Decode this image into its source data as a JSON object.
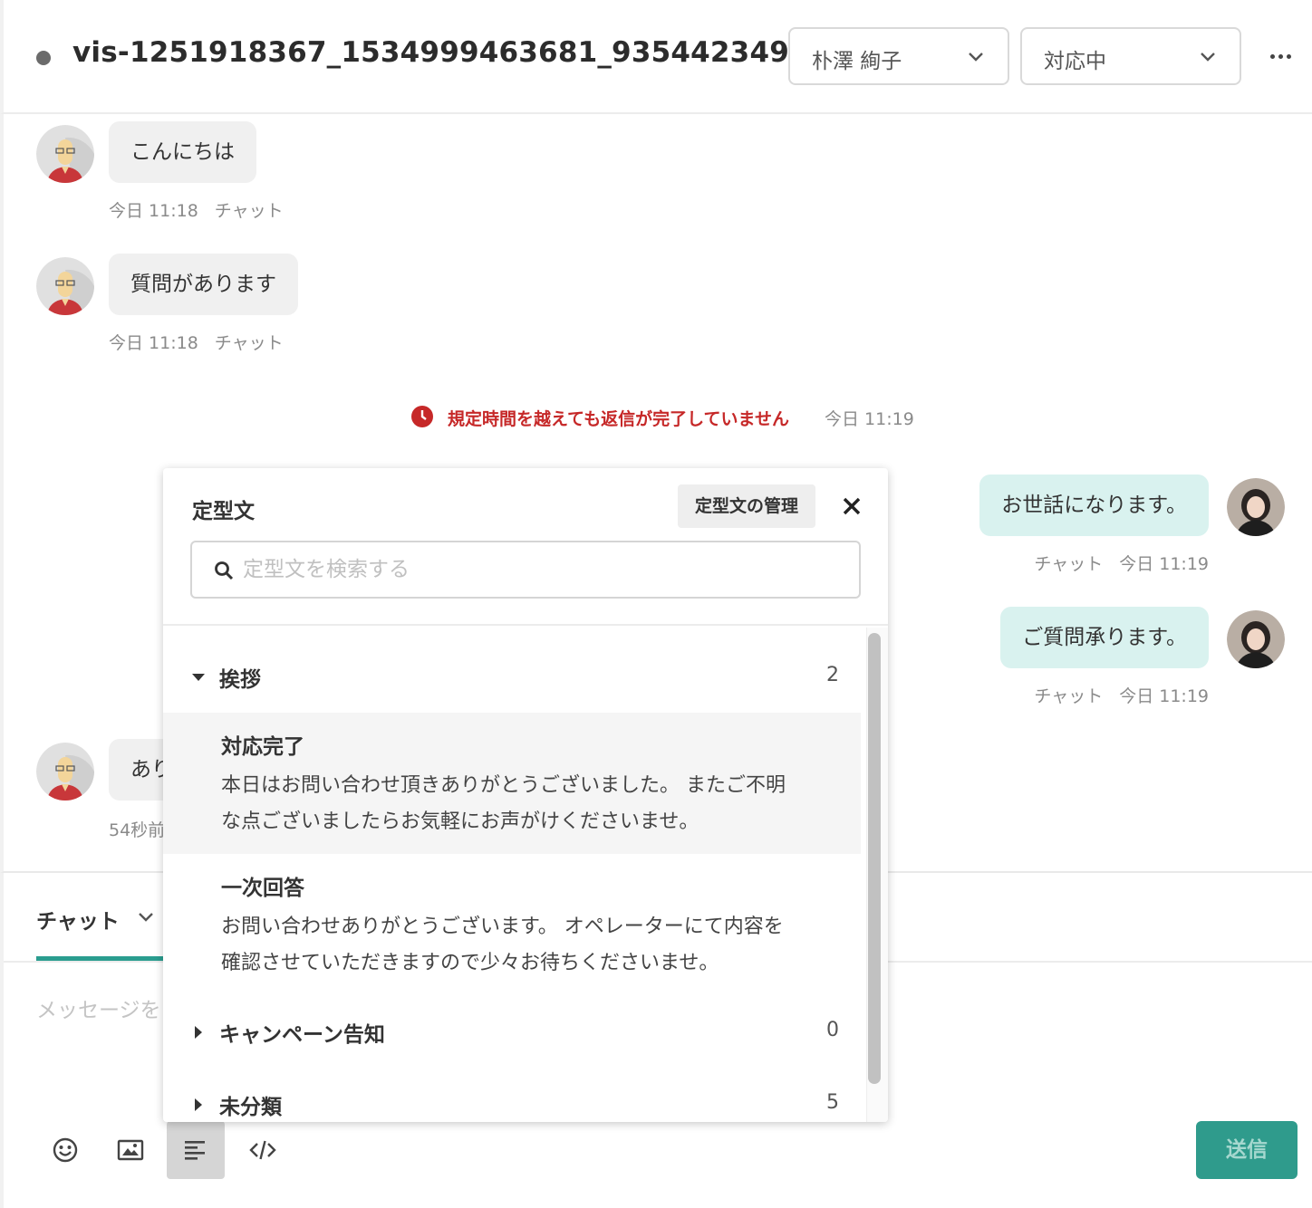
{
  "header": {
    "title": "vis-1251918367_1534999463681_935442349",
    "assignee": "朴澤 絢子",
    "status": "対応中"
  },
  "messages": [
    {
      "text": "こんにちは",
      "time": "今日 11:18",
      "channel": "チャット"
    },
    {
      "text": "質問があります",
      "time": "今日 11:18",
      "channel": "チャット"
    },
    {
      "text": "お世話になります。",
      "channel": "チャット",
      "time": "今日 11:19"
    },
    {
      "text": "ご質問承ります。",
      "channel": "チャット",
      "time": "今日 11:19"
    },
    {
      "text": "あり",
      "time": "54秒前"
    }
  ],
  "alert": {
    "text": "規定時間を越えても返信が完了していません",
    "time": "今日 11:19",
    "color": "#c62828"
  },
  "templates": {
    "title": "定型文",
    "manage_label": "定型文の管理",
    "search_placeholder": "定型文を検索する",
    "categories": [
      {
        "name": "挨拶",
        "count": "2"
      },
      {
        "name": "キャンペーン告知",
        "count": "0"
      },
      {
        "name": "未分類",
        "count": "5"
      }
    ],
    "items": [
      {
        "title": "対応完了",
        "line1": "本日はお問い合わせ頂きありがとうございました。 またご不明",
        "line2": "な点ございましたらお気軽にお声がけくださいませ。"
      },
      {
        "title": "一次回答",
        "line1": "お問い合わせありがとうございます。 オペレーターにて内容を",
        "line2": "確認させていただきますので少々お待ちくださいませ。"
      }
    ]
  },
  "composer": {
    "channel": "チャット",
    "placeholder": "メッセージを",
    "send_label": "送信",
    "tools": [
      "emoji-icon",
      "image-icon",
      "template-icon",
      "code-icon"
    ]
  },
  "colors": {
    "accent": "#2a9d8f",
    "outgoing_bubble": "#d9f2ef",
    "incoming_bubble": "#f0f0f0",
    "send_button": "#2f9b8c"
  }
}
